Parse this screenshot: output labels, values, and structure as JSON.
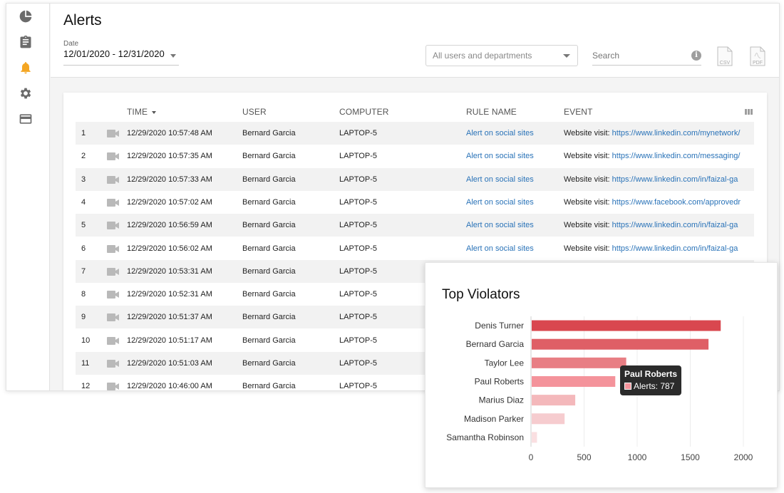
{
  "app": {
    "title": "Alerts",
    "date_label": "Date",
    "date_value": "12/01/2020 - 12/31/2020",
    "dept_placeholder": "All users and departments",
    "search_placeholder": "Search",
    "info_glyph": "i"
  },
  "sidebar": {
    "items": [
      {
        "icon": "pie-chart-icon"
      },
      {
        "icon": "clipboard-icon"
      },
      {
        "icon": "bell-icon",
        "active": true,
        "color": "#f4a623"
      },
      {
        "icon": "gear-icon"
      },
      {
        "icon": "card-icon"
      }
    ]
  },
  "exports": {
    "csv_label": "CSV",
    "pdf_label": "PDF"
  },
  "table": {
    "columns": {
      "time": "TIME",
      "user": "USER",
      "computer": "COMPUTER",
      "rule": "RULE NAME",
      "event": "EVENT"
    },
    "rows": [
      {
        "num": "1",
        "time": "12/29/2020 10:57:48 AM",
        "user": "Bernard Garcia",
        "computer": "LAPTOP-5",
        "rule": "Alert on social sites",
        "event_prefix": "Website visit:",
        "event_url": "https://www.linkedin.com/mynetwork/"
      },
      {
        "num": "2",
        "time": "12/29/2020 10:57:35 AM",
        "user": "Bernard Garcia",
        "computer": "LAPTOP-5",
        "rule": "Alert on social sites",
        "event_prefix": "Website visit:",
        "event_url": "https://www.linkedin.com/messaging/"
      },
      {
        "num": "3",
        "time": "12/29/2020 10:57:33 AM",
        "user": "Bernard Garcia",
        "computer": "LAPTOP-5",
        "rule": "Alert on social sites",
        "event_prefix": "Website visit:",
        "event_url": "https://www.linkedin.com/in/faizal-ga"
      },
      {
        "num": "4",
        "time": "12/29/2020 10:57:02 AM",
        "user": "Bernard Garcia",
        "computer": "LAPTOP-5",
        "rule": "Alert on social sites",
        "event_prefix": "Website visit:",
        "event_url": "https://www.facebook.com/approvedr"
      },
      {
        "num": "5",
        "time": "12/29/2020 10:56:59 AM",
        "user": "Bernard Garcia",
        "computer": "LAPTOP-5",
        "rule": "Alert on social sites",
        "event_prefix": "Website visit:",
        "event_url": "https://www.linkedin.com/in/faizal-ga"
      },
      {
        "num": "6",
        "time": "12/29/2020 10:56:02 AM",
        "user": "Bernard Garcia",
        "computer": "LAPTOP-5",
        "rule": "Alert on social sites",
        "event_prefix": "Website visit:",
        "event_url": "https://www.linkedin.com/in/faizal-ga"
      },
      {
        "num": "7",
        "time": "12/29/2020 10:53:31 AM",
        "user": "Bernard Garcia",
        "computer": "LAPTOP-5",
        "rule": "",
        "event_prefix": "",
        "event_url": ""
      },
      {
        "num": "8",
        "time": "12/29/2020 10:52:31 AM",
        "user": "Bernard Garcia",
        "computer": "LAPTOP-5",
        "rule": "",
        "event_prefix": "",
        "event_url": ""
      },
      {
        "num": "9",
        "time": "12/29/2020 10:51:37 AM",
        "user": "Bernard Garcia",
        "computer": "LAPTOP-5",
        "rule": "",
        "event_prefix": "",
        "event_url": ""
      },
      {
        "num": "10",
        "time": "12/29/2020 10:51:17 AM",
        "user": "Bernard Garcia",
        "computer": "LAPTOP-5",
        "rule": "",
        "event_prefix": "",
        "event_url": ""
      },
      {
        "num": "11",
        "time": "12/29/2020 10:51:03 AM",
        "user": "Bernard Garcia",
        "computer": "LAPTOP-5",
        "rule": "",
        "event_prefix": "",
        "event_url": ""
      },
      {
        "num": "12",
        "time": "12/29/2020 10:46:00 AM",
        "user": "Bernard Garcia",
        "computer": "LAPTOP-5",
        "rule": "",
        "event_prefix": "",
        "event_url": ""
      }
    ]
  },
  "top_violators": {
    "title": "Top Violators",
    "tooltip_name": "Paul Roberts",
    "tooltip_text": "Alerts: 787"
  },
  "chart_data": {
    "type": "bar",
    "orientation": "horizontal",
    "title": "Top Violators",
    "categories": [
      "Denis Turner",
      "Bernard Garcia",
      "Taylor Lee",
      "Paul Roberts",
      "Marius Diaz",
      "Madison Parker",
      "Samantha Robinson"
    ],
    "values": [
      1780,
      1665,
      890,
      787,
      410,
      310,
      50
    ],
    "colors": [
      "#d9474f",
      "#df5f66",
      "#e87e84",
      "#f4939b",
      "#f4b8bb",
      "#f6cccf",
      "#fadfe1"
    ],
    "xlim": [
      0,
      2000
    ],
    "xticks": [
      0,
      500,
      1000,
      1500,
      2000
    ],
    "grid": true,
    "xlabel": "",
    "ylabel": ""
  }
}
